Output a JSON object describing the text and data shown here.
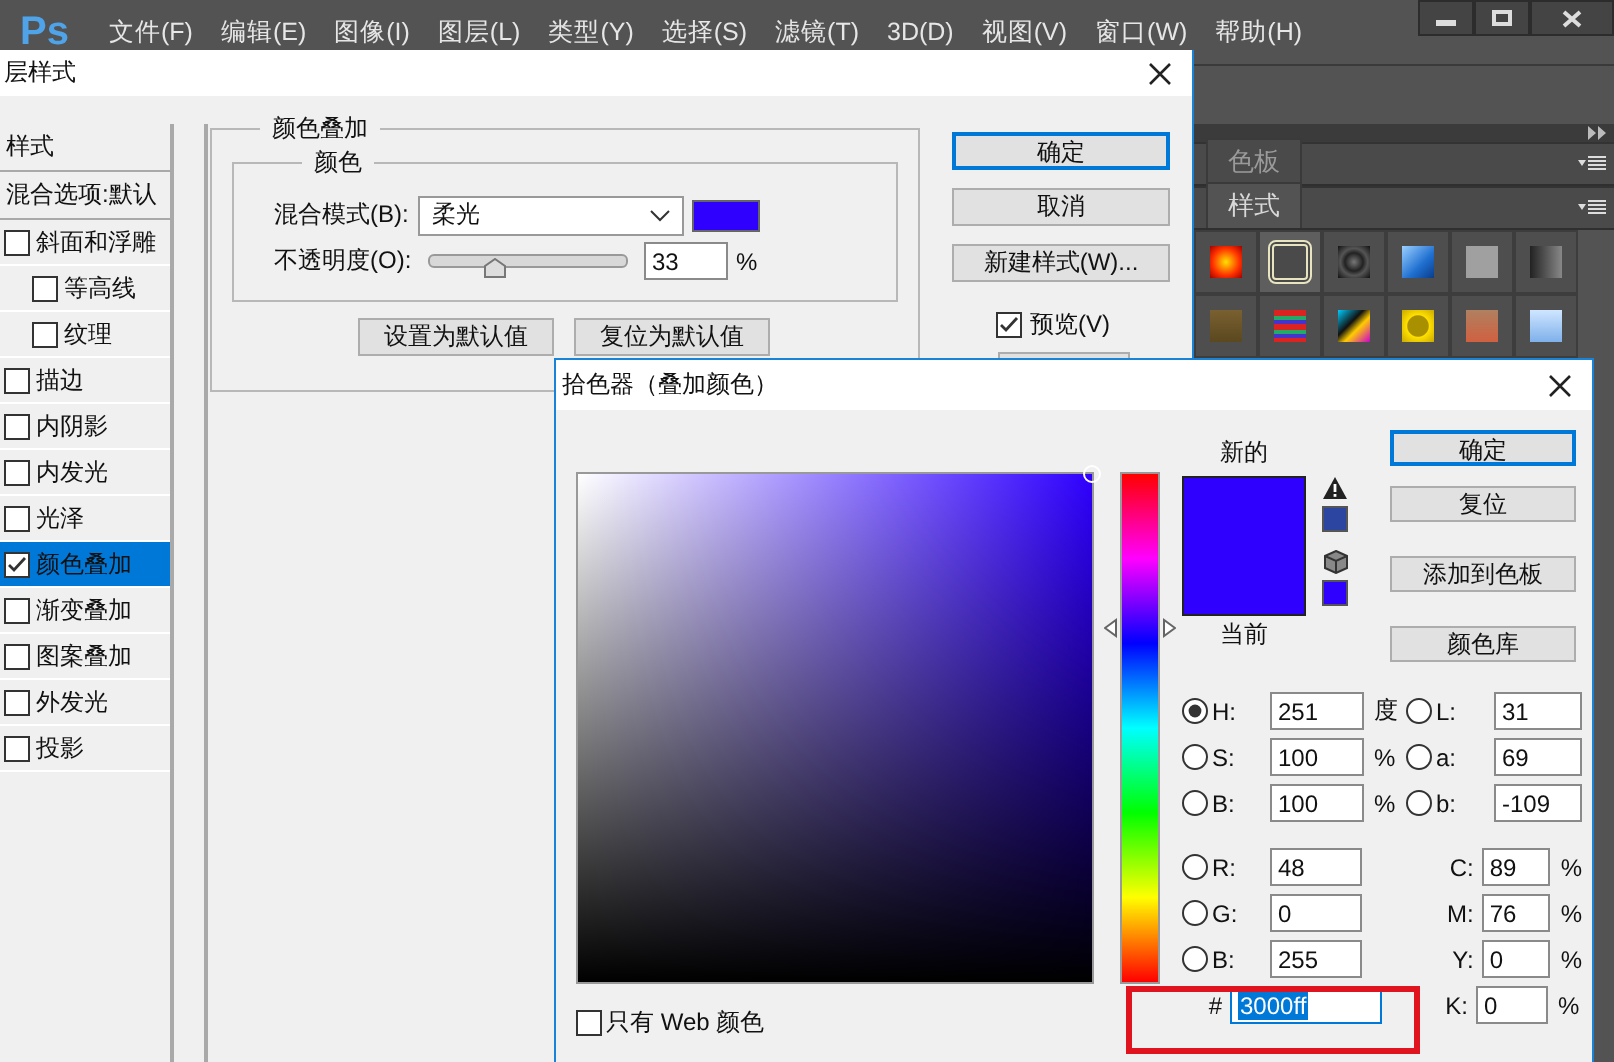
{
  "app": {
    "logo": "Ps",
    "menu": [
      "文件(F)",
      "编辑(E)",
      "图像(I)",
      "图层(L)",
      "类型(Y)",
      "选择(S)",
      "滤镜(T)",
      "3D(D)",
      "视图(V)",
      "窗口(W)",
      "帮助(H)"
    ]
  },
  "panels": [
    {
      "tab": "色板",
      "selected": false
    },
    {
      "tab": "样式",
      "selected": true
    }
  ],
  "styles": [
    {
      "selected": false
    },
    {
      "selected": true
    },
    {
      "selected": false
    },
    {
      "selected": false
    },
    {
      "selected": false
    },
    {
      "selected": false
    },
    {
      "selected": false
    },
    {
      "selected": false
    },
    {
      "selected": false
    },
    {
      "selected": false
    },
    {
      "selected": false
    },
    {
      "selected": false
    }
  ],
  "layer_style": {
    "title": "层样式",
    "list_header": "样式",
    "blending_options": "混合选项:默认",
    "effects": [
      {
        "label": "斜面和浮雕",
        "checked": false,
        "selected": false,
        "children": [
          {
            "label": "等高线",
            "checked": false,
            "selected": false
          },
          {
            "label": "纹理",
            "checked": false,
            "selected": false
          }
        ]
      },
      {
        "label": "描边",
        "checked": false,
        "selected": false
      },
      {
        "label": "内阴影",
        "checked": false,
        "selected": false
      },
      {
        "label": "内发光",
        "checked": false,
        "selected": false
      },
      {
        "label": "光泽",
        "checked": false,
        "selected": false
      },
      {
        "label": "颜色叠加",
        "checked": true,
        "selected": true
      },
      {
        "label": "渐变叠加",
        "checked": false,
        "selected": false
      },
      {
        "label": "图案叠加",
        "checked": false,
        "selected": false
      },
      {
        "label": "外发光",
        "checked": false,
        "selected": false
      },
      {
        "label": "投影",
        "checked": false,
        "selected": false
      }
    ],
    "section_title": "颜色叠加",
    "group_title": "颜色",
    "blend_mode_label": "混合模式(B):",
    "blend_mode": "柔光",
    "opacity_label": "不透明度(O):",
    "opacity": {
      "level": 0.33,
      "value": "33",
      "unit": "%"
    },
    "default_buttons": [
      "设置为默认值",
      "复位为默认值"
    ],
    "buttons": [
      {
        "label": "确定",
        "default": true
      },
      {
        "label": "取消",
        "default": false
      },
      {
        "label": "新建样式(W)...",
        "default": false
      }
    ],
    "preview": {
      "label": "预览(V)",
      "checked": true
    }
  },
  "color_picker": {
    "title": "拾色器（叠加颜色）",
    "new_label": "新的",
    "current_label": "当前",
    "buttons": [
      {
        "label": "确定",
        "default": true
      },
      {
        "label": "复位",
        "default": false
      },
      {
        "label": "添加到色板",
        "default": false
      },
      {
        "label": "颜色库",
        "default": false
      }
    ],
    "hsb": [
      {
        "label": "H:",
        "value": "251",
        "unit": "度",
        "selected": true
      },
      {
        "label": "S:",
        "value": "100",
        "unit": "%",
        "selected": false
      },
      {
        "label": "B:",
        "value": "100",
        "unit": "%",
        "selected": false
      }
    ],
    "lab": [
      {
        "label": "L:",
        "value": "31",
        "selected": false
      },
      {
        "label": "a:",
        "value": "69",
        "selected": false
      },
      {
        "label": "b:",
        "value": "-109",
        "selected": false
      }
    ],
    "rgb": [
      {
        "label": "R:",
        "value": "48",
        "selected": false
      },
      {
        "label": "G:",
        "value": "0",
        "selected": false
      },
      {
        "label": "B:",
        "value": "255",
        "selected": false
      }
    ],
    "cmyk": [
      {
        "label": "C:",
        "value": "89",
        "unit": "%"
      },
      {
        "label": "M:",
        "value": "76",
        "unit": "%"
      },
      {
        "label": "Y:",
        "value": "0",
        "unit": "%"
      },
      {
        "label": "K:",
        "value": "0",
        "unit": "%"
      }
    ],
    "hex": {
      "label": "#",
      "value": "3000ff",
      "text_selected": true
    },
    "web_only": {
      "label": "只有 Web 颜色",
      "checked": false
    }
  }
}
